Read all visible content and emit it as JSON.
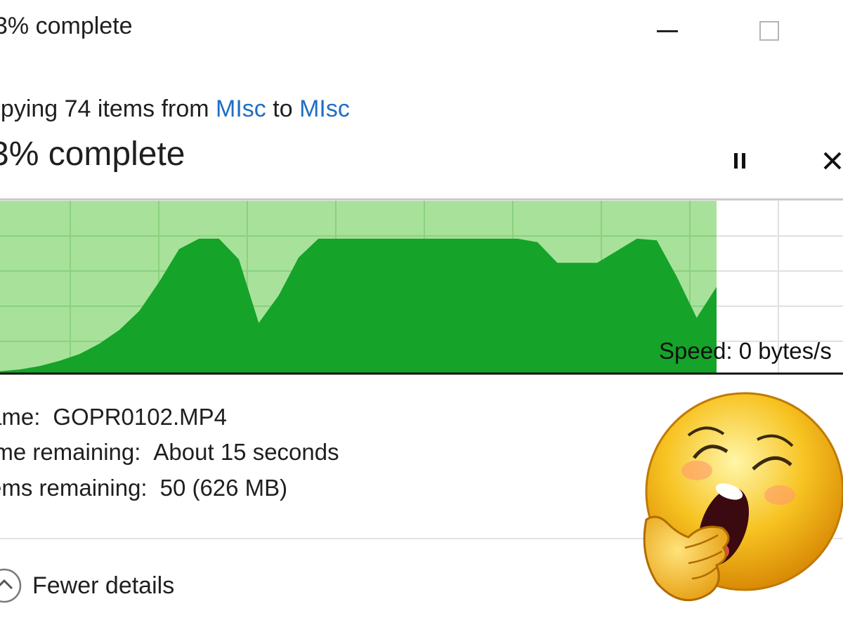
{
  "window": {
    "title": "3% complete",
    "icons": {
      "minimize": "minimize-icon",
      "maximize": "maximize-icon"
    }
  },
  "copy": {
    "prefix": "opying 74 items from ",
    "source": "MIsc",
    "to": " to ",
    "destination": "MIsc",
    "link_color": "#1e6fc4"
  },
  "progress": {
    "heading": "3% complete",
    "percent": 3,
    "pause_icon": "pause-icon",
    "close_icon": "close-icon"
  },
  "speed_chart": {
    "speed_label": "Speed: 0 bytes/s",
    "fill_light": "#a8e29a",
    "fill_dark": "#15a32a",
    "grid_color": "#8bd17e",
    "profile": [
      0.01,
      0.02,
      0.04,
      0.07,
      0.11,
      0.17,
      0.25,
      0.36,
      0.53,
      0.72,
      0.78,
      0.78,
      0.66,
      0.29,
      0.45,
      0.67,
      0.78,
      0.78,
      0.78,
      0.78,
      0.78,
      0.78,
      0.78,
      0.78,
      0.78,
      0.78,
      0.78,
      0.76,
      0.64,
      0.64,
      0.64,
      0.71,
      0.78,
      0.77,
      0.56,
      0.32,
      0.5
    ]
  },
  "details": {
    "name_label": "ame:",
    "name_value": "GOPR0102.MP4",
    "time_label": "ime remaining:",
    "time_value": "About 15 seconds",
    "items_label": "ems remaining:",
    "items_value": "50 (626 MB)"
  },
  "footer": {
    "fewer_details": "Fewer details",
    "chevron_icon": "chevron-up-icon"
  },
  "overlay": {
    "emoji": "yawning-emoji-icon"
  }
}
